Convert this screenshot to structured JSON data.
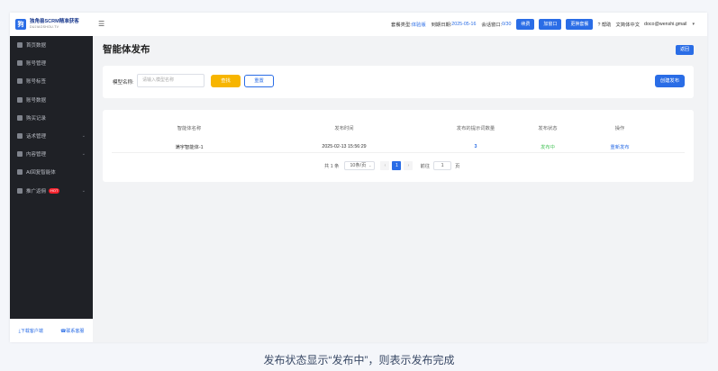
{
  "app": {
    "logo_mark": "狗",
    "logo_title": "独角兽SCRM精准获客",
    "logo_subtitle": "DUJIAOSHOU.TV"
  },
  "sidebar": {
    "items": [
      {
        "label": "首页数据"
      },
      {
        "label": "账号管理"
      },
      {
        "label": "账号标签"
      },
      {
        "label": "账号数据"
      },
      {
        "label": "购买记录"
      },
      {
        "label": "话术管理",
        "expandable": true
      },
      {
        "label": "内容管理",
        "expandable": true
      },
      {
        "label": "AI回复智能体"
      },
      {
        "label": "推广返佣",
        "badge": "HOT",
        "expandable": true
      }
    ],
    "footer": {
      "download": "⤓下载客户端",
      "contact": "☎联系客服"
    }
  },
  "topbar": {
    "package_label": "套餐类型:",
    "package_value": "体验版",
    "expire_label": "到期日期:",
    "expire_value": "2025-05-16",
    "window_label": "会话窗口:",
    "window_value": "0/30",
    "renew": "续费",
    "add_window": "加窗口",
    "change_plan": "更换套餐",
    "help": "帮助",
    "language": "简体中文",
    "user": "doco@wenshi.gmail"
  },
  "page": {
    "title": "智能体发布",
    "back": "返回"
  },
  "search": {
    "label": "模型名称:",
    "placeholder": "请输入模型名称",
    "search_btn": "查找",
    "reset_btn": "重置",
    "create_btn": "创建发布"
  },
  "table": {
    "headers": [
      "智能体名称",
      "发布时间",
      "发布的提示词数量",
      "发布状态",
      "操作"
    ],
    "rows": [
      {
        "name": "满宇智能体-1",
        "time": "2025-02-13 15:56:29",
        "count": "3",
        "status": "发布中",
        "action": "重新发布"
      }
    ]
  },
  "pagination": {
    "total": "共 1 条",
    "page_size": "10条/页",
    "prev": "‹",
    "current": "1",
    "next": "›",
    "goto_label": "前往",
    "goto_value": "1",
    "page_unit": "页"
  },
  "caption": "发布状态显示“发布中”，则表示发布完成"
}
